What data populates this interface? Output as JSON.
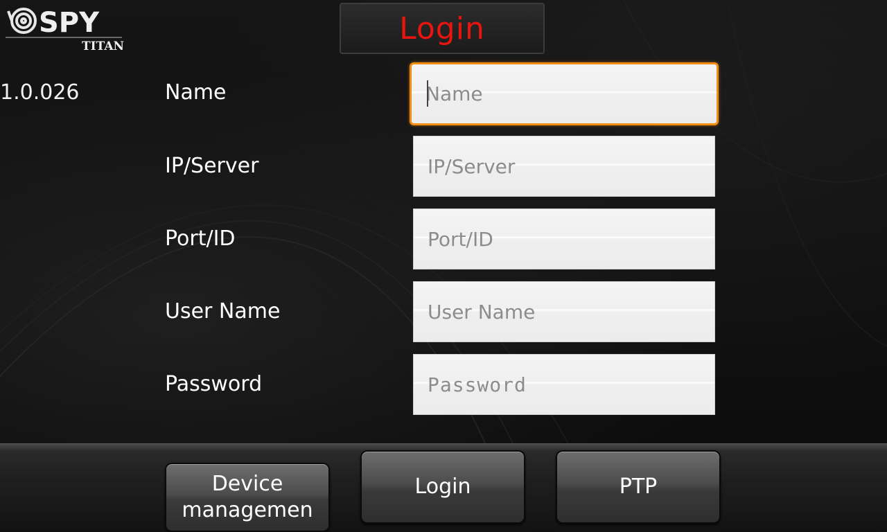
{
  "header": {
    "logo_text": "SPY",
    "logo_subtitle": "TITAN",
    "title": "Login",
    "title_color": "#e8140e"
  },
  "version": "1.0.026",
  "form": {
    "fields": [
      {
        "label": "Name",
        "placeholder": "Name",
        "value": "",
        "focused": true
      },
      {
        "label": "IP/Server",
        "placeholder": "IP/Server",
        "value": ""
      },
      {
        "label": "Port/ID",
        "placeholder": "Port/ID",
        "value": ""
      },
      {
        "label": "User Name",
        "placeholder": "User Name",
        "value": ""
      },
      {
        "label": "Password",
        "placeholder": "Password",
        "value": ""
      }
    ],
    "focus_color": "#f28c12"
  },
  "bottom_bar": {
    "device_management_line1": "Device",
    "device_management_line2": "managemen",
    "login_label": "Login",
    "ptp_label": "PTP"
  }
}
